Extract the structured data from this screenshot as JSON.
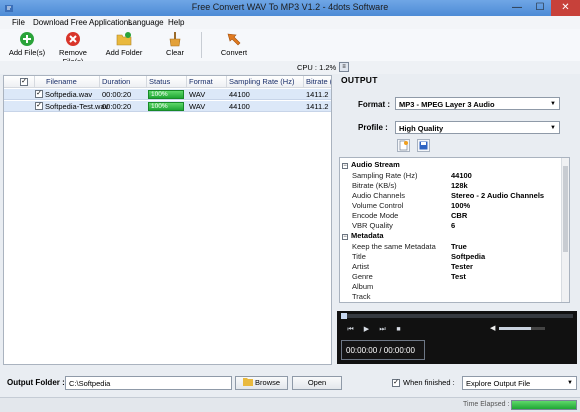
{
  "window": {
    "title": "Free Convert WAV To MP3 V1.2 - 4dots Software",
    "min_label": "—",
    "max_label": "☐",
    "close_label": "✕"
  },
  "menu": [
    "File",
    "Download Free Applications",
    "Language",
    "Help"
  ],
  "toolbar": {
    "add_files": "Add File(s)",
    "remove_files": "Remove File(s)",
    "add_folder": "Add Folder",
    "clear": "Clear",
    "convert": "Convert"
  },
  "cpu": {
    "text": "CPU : 1.2%",
    "button_label": "≡"
  },
  "file_table": {
    "columns": [
      "Filename",
      "Duration",
      "Status",
      "Format",
      "Sampling Rate (Hz)",
      "Bitrate (KB/s)"
    ],
    "rows": [
      {
        "checked": "✓",
        "filename": "Softpedia.wav",
        "duration": "00:00:20",
        "status": "100%",
        "status_progress": 1.0,
        "format": "WAV",
        "sampling_rate": "44100",
        "bitrate": "1411.2"
      },
      {
        "checked": "✓",
        "filename": "Softpedia-Test.wav",
        "duration": "00:00:20",
        "status": "100%",
        "status_progress": 1.0,
        "format": "WAV",
        "sampling_rate": "44100",
        "bitrate": "1411.2"
      }
    ],
    "header_check": "✓"
  },
  "output": {
    "title": "OUTPUT",
    "format_label": "Format :",
    "format_value": "MP3 - MPEG Layer 3 Audio",
    "profile_label": "Profile :",
    "profile_value": "High Quality"
  },
  "properties": {
    "groups": [
      {
        "title": "Audio Stream",
        "toggle": "−",
        "items": [
          {
            "name": "Sampling Rate (Hz)",
            "value": "44100"
          },
          {
            "name": "Bitrate (KB/s)",
            "value": "128k"
          },
          {
            "name": "Audio Channels",
            "value": "Stereo - 2 Audio Channels"
          },
          {
            "name": "Volume Control",
            "value": "100%"
          },
          {
            "name": "Encode Mode",
            "value": "CBR"
          },
          {
            "name": "VBR Quality",
            "value": "6"
          }
        ]
      },
      {
        "title": "Metadata",
        "toggle": "−",
        "items": [
          {
            "name": "Keep the same Metadata",
            "value": "True"
          },
          {
            "name": "Title",
            "value": "Softpedia"
          },
          {
            "name": "Artist",
            "value": "Tester"
          },
          {
            "name": "Genre",
            "value": "Test"
          },
          {
            "name": "Album",
            "value": ""
          },
          {
            "name": "Track",
            "value": ""
          }
        ]
      }
    ]
  },
  "player": {
    "time": "00:00:00 / 00:00:00",
    "volume_level": 0.7,
    "prev_label": "⏮",
    "play_label": "▶",
    "next_label": "⏭",
    "stop_label": "■",
    "mute_label": "◀"
  },
  "bottom": {
    "output_folder_label": "Output Folder :",
    "output_folder_value": "C:\\Softpedia",
    "browse": "Browse",
    "open": "Open",
    "when_finished_label": "When finished :",
    "when_finished_checked": "✓",
    "when_finished_value": "Explore Output File"
  },
  "status": {
    "time_elapsed_label": "Time Elapsed :",
    "elapsed_progress": 1.0
  },
  "colors": {
    "accent": "#4d8bd6",
    "progress_green": "#1fa634",
    "close_red": "#c7413a"
  }
}
